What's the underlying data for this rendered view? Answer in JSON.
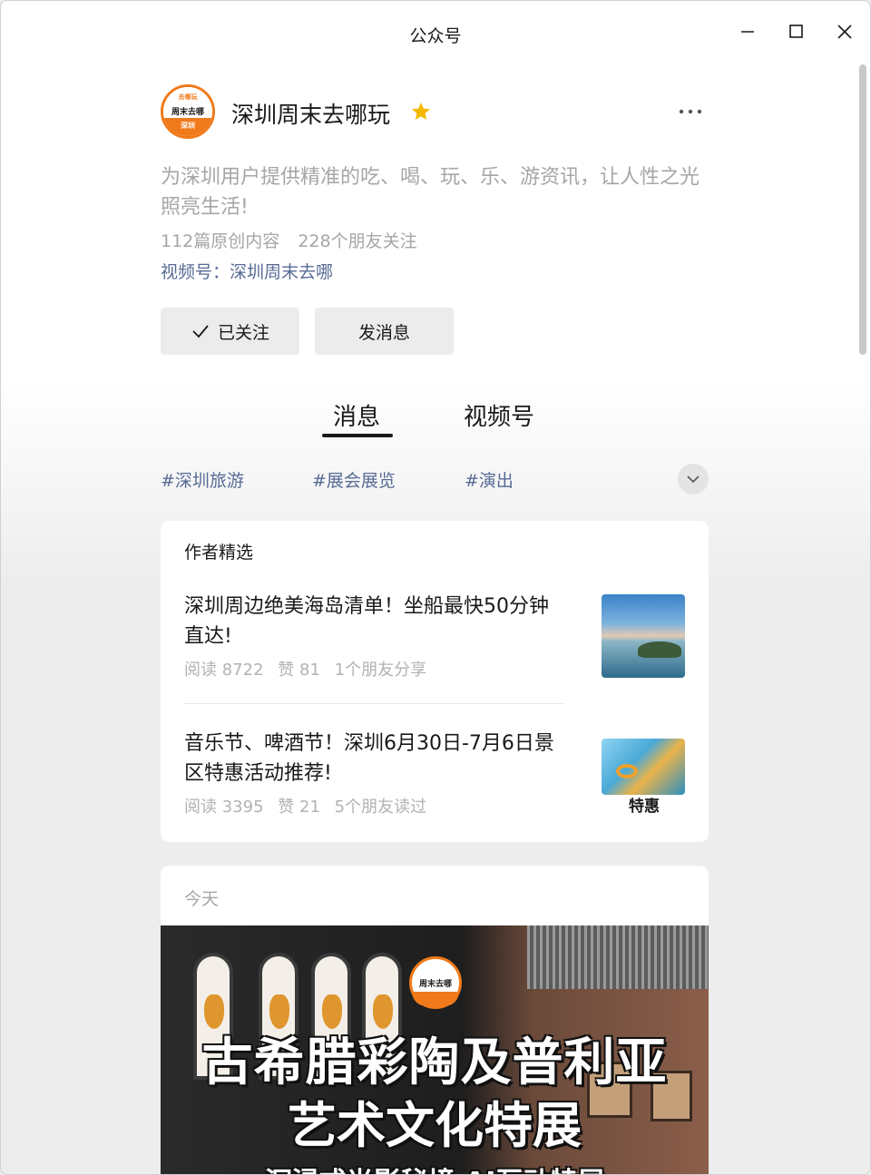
{
  "window": {
    "title": "公众号"
  },
  "account": {
    "name": "深圳周末去哪玩",
    "avatar_text_top": "去哪玩",
    "avatar_text_mid": "周末去哪",
    "avatar_text_bottom": "深圳",
    "description": "为深圳用户提供精准的吃、喝、玩、乐、游资讯，让人性之光照亮生活!",
    "original_count": "112篇原创内容",
    "friends_following": "228个朋友关注",
    "channel_link": "视频号：深圳周末去哪"
  },
  "actions": {
    "followed_label": "已关注",
    "message_label": "发消息"
  },
  "tabs": [
    {
      "label": "消息",
      "active": true
    },
    {
      "label": "视频号",
      "active": false
    }
  ],
  "tags": [
    "#深圳旅游",
    "#展会展览",
    "#演出"
  ],
  "featured": {
    "header": "作者精选",
    "articles": [
      {
        "title": "深圳周边绝美海岛清单！坐船最快50分钟直达!",
        "reads": "阅读 8722",
        "likes": "赞 81",
        "social": "1个朋友分享"
      },
      {
        "title": "音乐节、啤酒节！深圳6月30日-7月6日景区特惠活动推荐!",
        "reads": "阅读 3395",
        "likes": "赞 21",
        "social": "5个朋友读过",
        "thumb_label": "特惠"
      }
    ]
  },
  "today": {
    "label": "今天",
    "banner_line1": "古希腊彩陶及普利亚",
    "banner_line2": "艺术文化特展",
    "banner_line3": "沉浸式光影秘境   AI互动特展",
    "banner_logo_text": "周末去哪"
  },
  "colors": {
    "link": "#576b95",
    "brand_orange": "#f07a1a",
    "star": "#f5b800"
  }
}
